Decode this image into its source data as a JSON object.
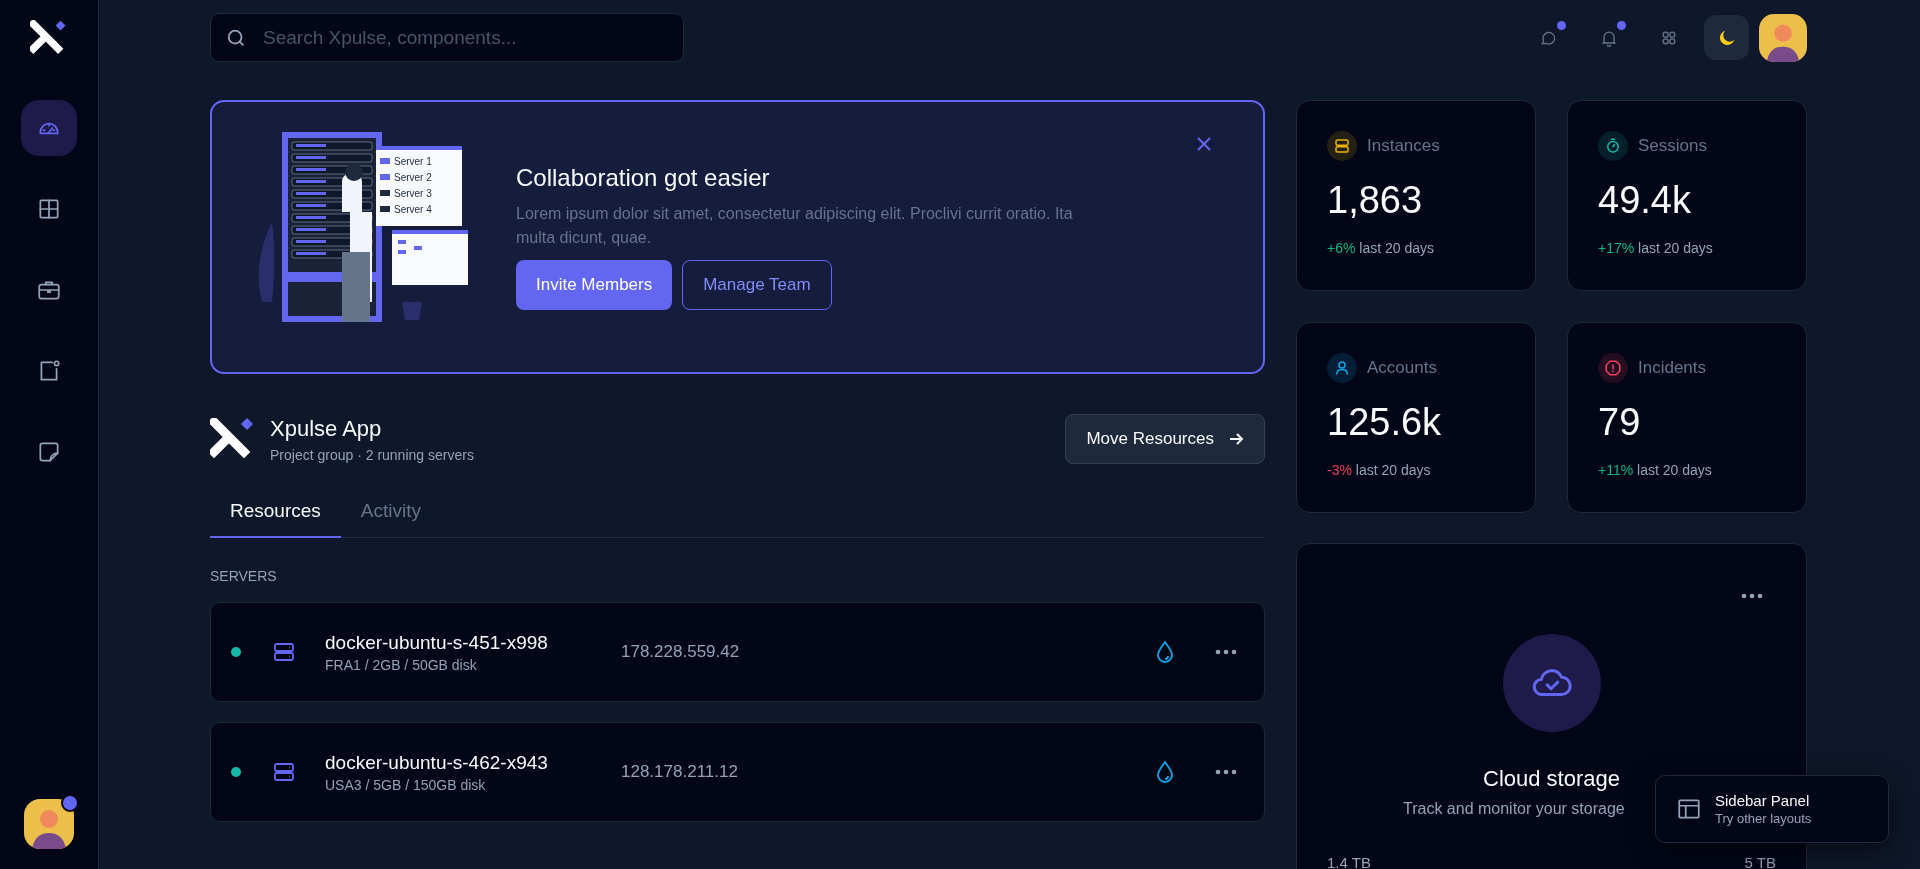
{
  "sidebar": {
    "items": [
      {
        "selected": true
      },
      {
        "selected": false
      },
      {
        "selected": false
      },
      {
        "selected": false
      },
      {
        "selected": false
      }
    ],
    "avatar_badge": true
  },
  "search": {
    "placeholder": "Search Xpulse, components..."
  },
  "topbar": {
    "icons": [
      {
        "dot": true
      },
      {
        "dot": true
      },
      {
        "dot": false
      }
    ],
    "dark_mode": true
  },
  "banner": {
    "title": "Collaboration got easier",
    "text": "Lorem ipsum dolor sit amet, consectetur adipiscing elit. Proclivi currit oratio. Ita multa dicunt, quae.",
    "buttons": [
      {
        "label": "Invite Members",
        "kind": "primary"
      },
      {
        "label": "Manage Team",
        "kind": "outline"
      }
    ],
    "illustration_labels": [
      "Server 1",
      "Server 2",
      "Server 3",
      "Server 4"
    ]
  },
  "project": {
    "name": "Xpulse App",
    "subtitle": "Project group · 2 running servers",
    "action": "Move Resources"
  },
  "tabs": [
    {
      "label": "Resources",
      "selected": true
    },
    {
      "label": "Activity",
      "selected": false
    }
  ],
  "servers": {
    "heading": "SERVERS",
    "rows": [
      {
        "name": "docker-ubuntu-s-451-x998",
        "specs": "FRA1 / 2GB / 50GB disk",
        "ip": "178.228.559.42",
        "online": true
      },
      {
        "name": "docker-ubuntu-s-462-x943",
        "specs": "USA3 / 5GB / 150GB disk",
        "ip": "128.178.211.12",
        "online": true
      }
    ]
  },
  "stats": [
    {
      "label": "Instances",
      "value": "1,863",
      "change": {
        "text": "+6%",
        "color": "#10b981"
      },
      "period": "last 20 days",
      "color": "#eab308"
    },
    {
      "label": "Sessions",
      "value": "49.4k",
      "change": {
        "text": "+17%",
        "color": "#10b981"
      },
      "period": "last 20 days",
      "color": "#14b8a6"
    },
    {
      "label": "Accounts",
      "value": "125.6k",
      "change": {
        "text": "-3%",
        "color": "#f43f5e"
      },
      "period": "last 20 days",
      "color": "#0ea5e9"
    },
    {
      "label": "Incidents",
      "value": "79",
      "change": {
        "text": "+11%",
        "color": "#10b981"
      },
      "period": "last 20 days",
      "color": "#f43f5e"
    }
  ],
  "cloud_storage": {
    "title": "Cloud storage",
    "text": "Track and monitor your storage",
    "used": "1.4 TB",
    "total": "5 TB"
  },
  "layout_popup": {
    "title": "Sidebar Panel",
    "text": "Try other layouts"
  }
}
